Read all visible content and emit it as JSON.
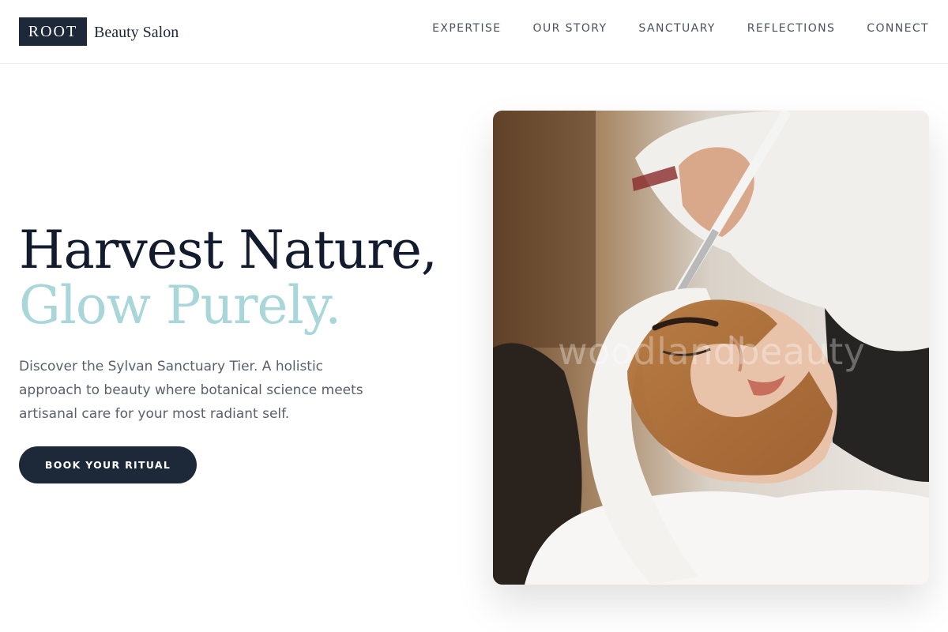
{
  "header": {
    "logo_mark": "ROOT",
    "logo_text": "Beauty Salon",
    "nav": [
      "EXPERTISE",
      "OUR STORY",
      "SANCTUARY",
      "REFLECTIONS",
      "CONNECT"
    ]
  },
  "hero": {
    "title_line1": "Harvest Nature,",
    "title_line2": "Glow Purely.",
    "description": "Discover the Sylvan Sanctuary Tier. A holistic approach to beauty where botanical science meets artisanal care for your most radiant self.",
    "cta_label": "BOOK YOUR RITUAL",
    "image_watermark": "woodlandbeauty"
  },
  "colors": {
    "navy": "#1d2838",
    "accent_teal": "#a9d6d9",
    "body_text": "#59606c"
  }
}
